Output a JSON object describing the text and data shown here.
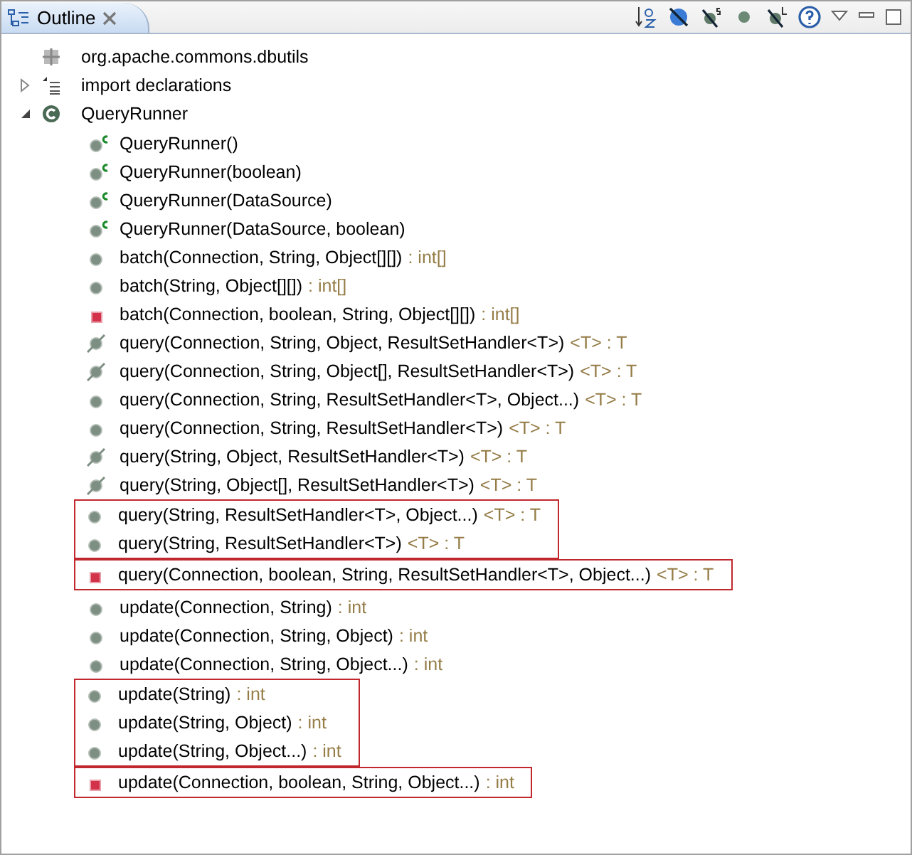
{
  "tab": {
    "label": "Outline",
    "selected": true
  },
  "tree": [
    {
      "kind": "package",
      "label": "org.apache.commons.dbutils"
    },
    {
      "kind": "imports",
      "label": "import declarations",
      "expanded": false
    },
    {
      "kind": "class",
      "label": "QueryRunner",
      "expanded": true,
      "groups": [
        {
          "highlighted": false,
          "members": [
            {
              "kind": "constructor",
              "name": "QueryRunner()"
            },
            {
              "kind": "constructor",
              "name": "QueryRunner(boolean)"
            },
            {
              "kind": "constructor",
              "name": "QueryRunner(DataSource)"
            },
            {
              "kind": "constructor",
              "name": "QueryRunner(DataSource, boolean)"
            },
            {
              "kind": "method",
              "name": "batch(Connection, String, Object[][])",
              "detail": ": int[]"
            },
            {
              "kind": "method",
              "name": "batch(String, Object[][])",
              "detail": ": int[]"
            },
            {
              "kind": "private",
              "name": "batch(Connection, boolean, String, Object[][])",
              "detail": ": int[]"
            },
            {
              "kind": "deprecated",
              "name": "query(Connection, String, Object, ResultSetHandler<T>)",
              "detail": "<T> : T"
            },
            {
              "kind": "deprecated",
              "name": "query(Connection, String, Object[], ResultSetHandler<T>)",
              "detail": "<T> : T"
            },
            {
              "kind": "method",
              "name": "query(Connection, String, ResultSetHandler<T>, Object...)",
              "detail": "<T> : T"
            },
            {
              "kind": "method",
              "name": "query(Connection, String, ResultSetHandler<T>)",
              "detail": "<T> : T"
            },
            {
              "kind": "deprecated",
              "name": "query(String, Object, ResultSetHandler<T>)",
              "detail": "<T> : T"
            },
            {
              "kind": "deprecated",
              "name": "query(String, Object[], ResultSetHandler<T>)",
              "detail": "<T> : T"
            }
          ]
        },
        {
          "highlighted": true,
          "members": [
            {
              "kind": "method",
              "name": "query(String, ResultSetHandler<T>, Object...)",
              "detail": "<T> : T"
            },
            {
              "kind": "method",
              "name": "query(String, ResultSetHandler<T>)",
              "detail": "<T> : T"
            }
          ]
        },
        {
          "highlighted": true,
          "members": [
            {
              "kind": "private",
              "name": "query(Connection, boolean, String, ResultSetHandler<T>, Object...)",
              "detail": "<T> : T"
            }
          ]
        },
        {
          "highlighted": false,
          "members": [
            {
              "kind": "method",
              "name": "update(Connection, String)",
              "detail": ": int"
            },
            {
              "kind": "method",
              "name": "update(Connection, String, Object)",
              "detail": ": int"
            },
            {
              "kind": "method",
              "name": "update(Connection, String, Object...)",
              "detail": ": int"
            }
          ]
        },
        {
          "highlighted": true,
          "members": [
            {
              "kind": "method",
              "name": "update(String)",
              "detail": ": int"
            },
            {
              "kind": "method",
              "name": "update(String, Object)",
              "detail": ": int"
            },
            {
              "kind": "method",
              "name": "update(String, Object...)",
              "detail": ": int"
            }
          ]
        },
        {
          "highlighted": true,
          "members": [
            {
              "kind": "private",
              "name": "update(Connection, boolean, String, Object...)",
              "detail": ": int"
            }
          ]
        }
      ]
    }
  ]
}
